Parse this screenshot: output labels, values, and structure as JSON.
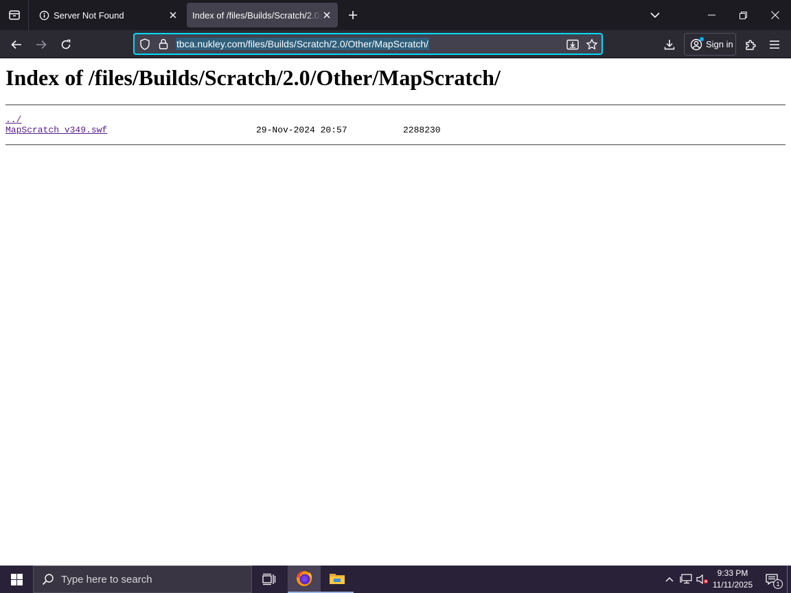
{
  "browser": {
    "tabs": [
      {
        "title": "Server Not Found",
        "active": false
      },
      {
        "title": "Index of /files/Builds/Scratch/2.0/Other/MapScratch/",
        "active": true
      }
    ],
    "url": "tbca.nukley.com/files/Builds/Scratch/2.0/Other/MapScratch/",
    "sign_in_label": "Sign in",
    "accent_color": "#00ddff"
  },
  "page": {
    "title": "Index of /files/Builds/Scratch/2.0/Other/MapScratch/",
    "entries": [
      {
        "name": "../",
        "date": "",
        "size": ""
      },
      {
        "name": "MapScratch_v349.swf",
        "date": "29-Nov-2024 20:57",
        "size": "2288230"
      }
    ],
    "link_color": "#551a8b"
  },
  "taskbar": {
    "search_placeholder": "Type here to search",
    "time": "9:33 PM",
    "date": "11/11/2025",
    "notification_count": "1"
  }
}
